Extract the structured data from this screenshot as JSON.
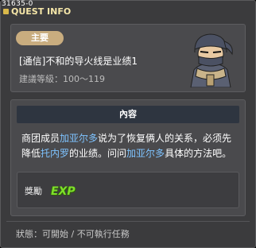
{
  "window": {
    "id": "31635-0",
    "title": "QUEST INFO"
  },
  "quest": {
    "category": "主要",
    "name": "[通信]不和的导火线是业绩1",
    "level_label": "建議等級：",
    "level_range": "100～119"
  },
  "content": {
    "header": "內容",
    "description": [
      {
        "text": "商团成员",
        "highlight": false
      },
      {
        "text": "加亚尔多",
        "highlight": true
      },
      {
        "text": "说为了恢复俩人的关系，必须先降低",
        "highlight": false
      },
      {
        "text": "托内罗",
        "highlight": true
      },
      {
        "text": "的业绩。问问",
        "highlight": false
      },
      {
        "text": "加亚尔多",
        "highlight": true
      },
      {
        "text": "具体的方法吧。",
        "highlight": false
      }
    ]
  },
  "reward": {
    "label": "獎勵",
    "icon_text": "EXP"
  },
  "status": {
    "label": "狀態：",
    "value": "可開始 / 不可執行任務"
  },
  "colors": {
    "highlight": "#7ec3ff",
    "badge": "#c9ad7f",
    "exp": "#7ee02a"
  }
}
